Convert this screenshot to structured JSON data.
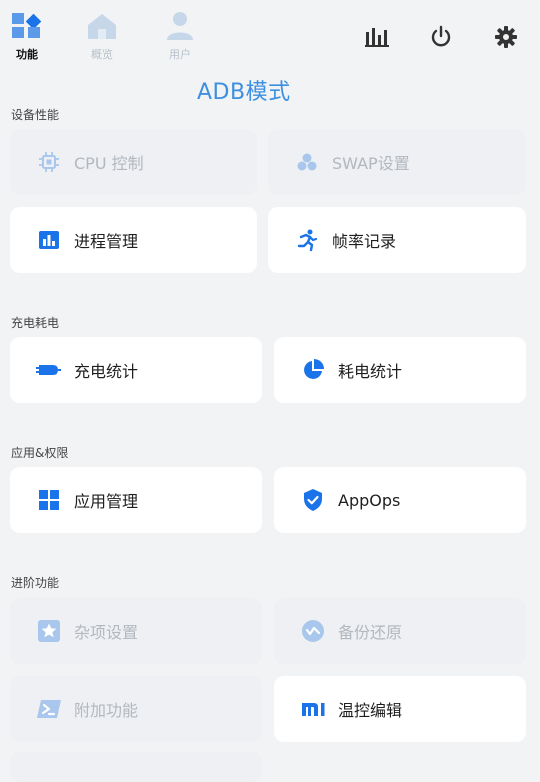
{
  "nav": {
    "tabs": [
      {
        "label": "功能",
        "icon": "grid-diamond-icon",
        "active": true
      },
      {
        "label": "概览",
        "icon": "home-icon",
        "active": false
      },
      {
        "label": "用户",
        "icon": "user-icon",
        "active": false
      }
    ],
    "actions": [
      {
        "icon": "bar-chart-icon"
      },
      {
        "icon": "power-icon"
      },
      {
        "icon": "gear-icon"
      }
    ]
  },
  "mode_label": "ADB模式",
  "sections": [
    {
      "title": "设备性能",
      "items": [
        {
          "label": "CPU 控制",
          "icon": "chip-icon",
          "enabled": false
        },
        {
          "label": "SWAP设置",
          "icon": "swap-dots-icon",
          "enabled": false
        },
        {
          "label": "进程管理",
          "icon": "process-bars-icon",
          "enabled": true
        },
        {
          "label": "帧率记录",
          "icon": "running-icon",
          "enabled": true
        }
      ]
    },
    {
      "title": "充电耗电",
      "items": [
        {
          "label": "充电统计",
          "icon": "charging-icon",
          "enabled": true
        },
        {
          "label": "耗电统计",
          "icon": "pie-icon",
          "enabled": true
        }
      ]
    },
    {
      "title": "应用&权限",
      "items": [
        {
          "label": "应用管理",
          "icon": "apps-grid-icon",
          "enabled": true
        },
        {
          "label": "AppOps",
          "icon": "shield-check-icon",
          "enabled": true
        }
      ]
    },
    {
      "title": "进阶功能",
      "items": [
        {
          "label": "杂项设置",
          "icon": "star-icon",
          "enabled": false
        },
        {
          "label": "备份还原",
          "icon": "backup-icon",
          "enabled": false
        },
        {
          "label": "附加功能",
          "icon": "terminal-icon",
          "enabled": false
        },
        {
          "label": "温控编辑",
          "icon": "mi-icon",
          "enabled": true
        }
      ]
    }
  ],
  "colors": {
    "accent": "#1a73e8",
    "mode_label": "#3d8fe0",
    "disabled_icon": "#a9c7ec"
  }
}
